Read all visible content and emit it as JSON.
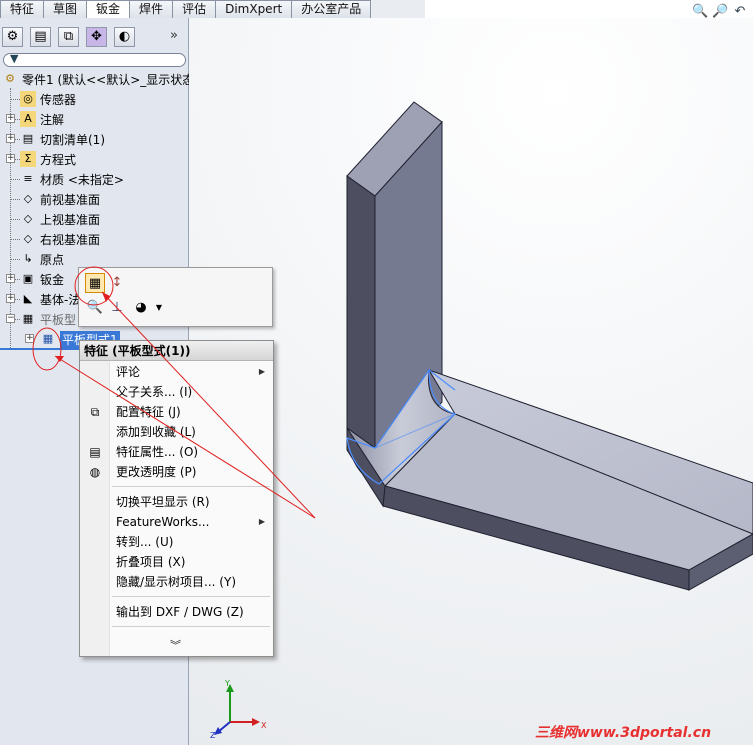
{
  "tabs": [
    "特征",
    "草图",
    "钣金",
    "焊件",
    "评估",
    "DimXpert",
    "办公室产品"
  ],
  "active_tab": "钣金",
  "panel": {
    "toolbar_icons": [
      "feature-manager-icon",
      "property-manager-icon",
      "configuration-manager-icon",
      "dimxpert-manager-icon",
      "display-manager-icon"
    ],
    "more_symbol": "»",
    "filter_icon": "funnel-icon"
  },
  "tree": {
    "root": "零件1 (默认<<默认>_显示状态",
    "items": [
      {
        "label": "传感器",
        "icon": "sensor-icon"
      },
      {
        "label": "注解",
        "icon": "annotation-icon"
      },
      {
        "label": "切割清单(1)",
        "icon": "cut-list-icon"
      },
      {
        "label": "方程式",
        "icon": "equation-icon"
      },
      {
        "label": "材质 <未指定>",
        "icon": "material-icon"
      },
      {
        "label": "前视基准面",
        "icon": "plane-icon"
      },
      {
        "label": "上视基准面",
        "icon": "plane-icon"
      },
      {
        "label": "右视基准面",
        "icon": "plane-icon"
      },
      {
        "label": "原点",
        "icon": "origin-icon"
      },
      {
        "label": "钣金",
        "icon": "sheet-metal-icon"
      },
      {
        "label": "基体-法",
        "icon": "base-flange-icon"
      },
      {
        "label": "平板型",
        "icon": "flat-pattern-icon"
      },
      {
        "label": "平板型式1",
        "icon": "flat-pattern-feature-icon"
      }
    ]
  },
  "context_menu": {
    "header": "特征 (平板型式(1))",
    "group1": [
      {
        "label": "评论",
        "submenu": true,
        "icon": ""
      },
      {
        "label": "父子关系... (I)",
        "submenu": false,
        "icon": ""
      },
      {
        "label": "配置特征 (J)",
        "submenu": false,
        "icon": "configure-feature-icon"
      },
      {
        "label": "添加到收藏 (L)",
        "submenu": false,
        "icon": ""
      },
      {
        "label": "特征属性... (O)",
        "submenu": false,
        "icon": "feature-properties-icon"
      },
      {
        "label": "更改透明度 (P)",
        "submenu": false,
        "icon": "transparency-icon"
      }
    ],
    "group2": [
      {
        "label": "切换平坦显示 (R)",
        "submenu": false
      },
      {
        "label": "FeatureWorks...",
        "submenu": true
      },
      {
        "label": "转到... (U)",
        "submenu": false
      },
      {
        "label": "折叠项目 (X)",
        "submenu": false
      },
      {
        "label": "隐藏/显示树项目... (Y)",
        "submenu": false
      }
    ],
    "group3": [
      {
        "label": "输出到 DXF / DWG (Z)",
        "submenu": false
      }
    ],
    "more_symbol": "»"
  },
  "triad": {
    "x": "X",
    "y": "Y",
    "z": "Z"
  },
  "watermark": "三维网www.3dportal.cn",
  "colors": {
    "panel_bg": "#e2e7ef",
    "annotation_red": "#e02020",
    "selection_blue": "#3a78d8"
  }
}
